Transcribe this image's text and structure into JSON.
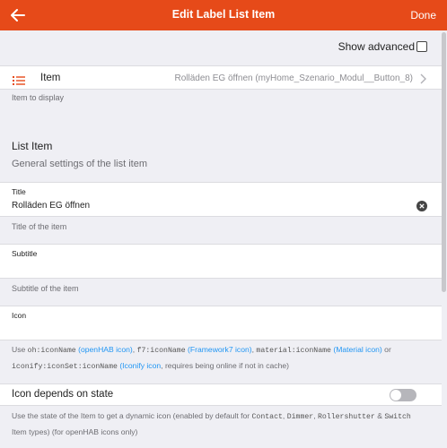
{
  "navbar": {
    "back_icon": "arrow-left-icon",
    "title": "Edit Label List Item",
    "done_label": "Done",
    "color": "#e64a19"
  },
  "advanced": {
    "label": "Show advanced",
    "checked": false
  },
  "item": {
    "icon": "list-icon",
    "label": "Item",
    "value": "Rolläden EG öffnen (myHome_Szenario_Modul__Button_8)",
    "chevron_icon": "chevron-right-icon",
    "footer": "Item to display"
  },
  "list_item_block": {
    "title": "List Item",
    "subtitle": "General settings of the list item"
  },
  "fields": {
    "title": {
      "label": "Title",
      "value": "Rolläden EG öffnen",
      "clear_icon": "clear-icon",
      "footer": "Title of the item"
    },
    "subtitle": {
      "label": "Subtitle",
      "value": "",
      "footer": "Subtitle of the item"
    },
    "icon": {
      "label": "Icon",
      "value": "",
      "footer": {
        "p1": "Use ",
        "c1": "oh:iconName",
        "l1": "(openHAB icon)",
        "p2": ", ",
        "c2": "f7:iconName",
        "l2": "(Framework7 icon)",
        "p3": ", ",
        "c3": "material:iconName",
        "l3": "(Material icon)",
        "p4": " or",
        "c4": "iconify:iconSet:iconName",
        "l4": "(Iconify icon",
        "p5": ", requires being online if not in cache)"
      }
    }
  },
  "icon_state": {
    "label": "Icon depends on state",
    "enabled": false,
    "footer": {
      "p1": "Use the state of the Item to get a dynamic icon (enabled by default for ",
      "c1": "Contact",
      "p2": ", ",
      "c2": "Dimmer",
      "p3": ", ",
      "c3": "Rollershutter",
      "p4": " & ",
      "c4": "Switch",
      "p5": "Item types) (for openHAB icons only)"
    }
  }
}
